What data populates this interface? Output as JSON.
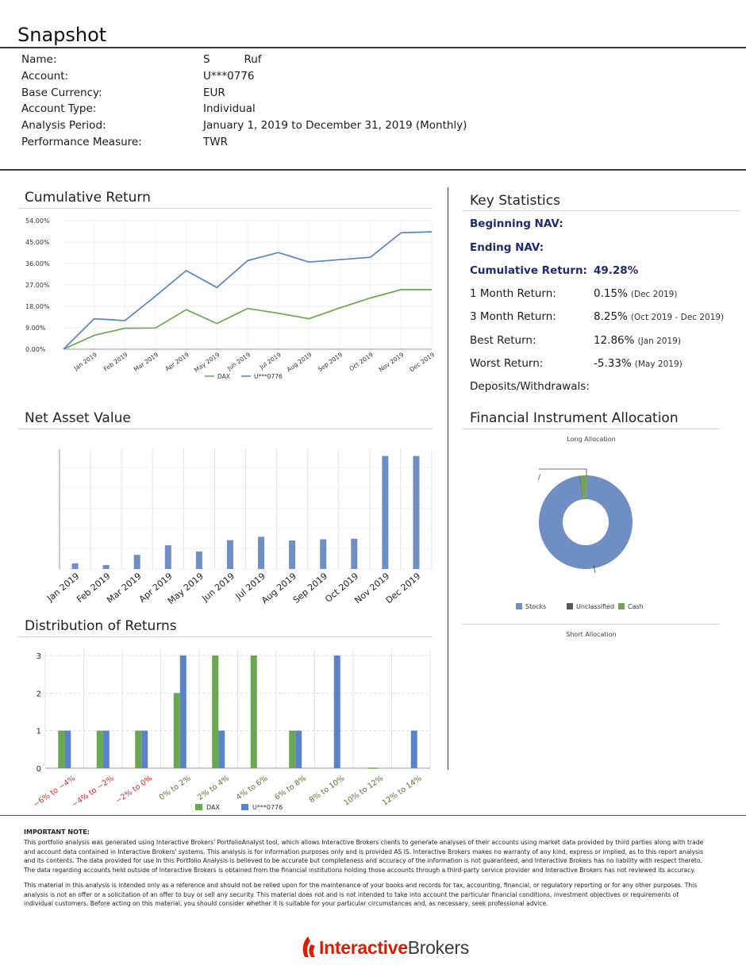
{
  "page": {
    "title": "Snapshot"
  },
  "account_info": [
    {
      "label": "Name:",
      "value": "S          Ruf"
    },
    {
      "label": "Account:",
      "value": "U***0776"
    },
    {
      "label": "Base Currency:",
      "value": "EUR"
    },
    {
      "label": "Account Type:",
      "value": "Individual"
    },
    {
      "label": "Analysis Period:",
      "value": "January 1, 2019 to December 31, 2019 (Monthly)"
    },
    {
      "label": "Performance Measure:",
      "value": "TWR"
    }
  ],
  "sections": {
    "cumulative_return": "Cumulative Return",
    "key_statistics": "Key Statistics",
    "net_asset_value": "Net Asset Value",
    "allocation": "Financial Instrument Allocation",
    "distribution": "Distribution of Returns"
  },
  "key_stats": {
    "beginning_nav_label": "Beginning NAV:",
    "ending_nav_label": "Ending NAV:",
    "cumulative_label": "Cumulative Return:",
    "cumulative_value": "49.28%",
    "one_month_label": "1 Month Return:",
    "one_month_value": "0.15%",
    "one_month_period": "(Dec 2019)",
    "three_month_label": "3 Month Return:",
    "three_month_value": "8.25%",
    "three_month_period": "(Oct 2019 - Dec 2019)",
    "best_label": "Best Return:",
    "best_value": "12.86%",
    "best_period": "(Jan 2019)",
    "worst_label": "Worst Return:",
    "worst_value": "-5.33%",
    "worst_period": "(May 2019)",
    "deposits_label": "Deposits/Withdrawals:"
  },
  "allocation": {
    "long_title": "Long Allocation",
    "short_title": "Short Allocation",
    "slash_label": "/",
    "legend": [
      {
        "name": "Stocks",
        "color": "#6f8fc4"
      },
      {
        "name": "Unclassified",
        "color": "#5a5a5a"
      },
      {
        "name": "Cash",
        "color": "#72a456"
      }
    ]
  },
  "chart_data": [
    {
      "type": "line",
      "categories": [
        "Jan 2019",
        "Feb 2019",
        "Mar 2019",
        "Apr 2019",
        "May 2019",
        "Jun 2019",
        "Jul 2019",
        "Aug 2019",
        "Sep 2019",
        "Oct 2019",
        "Nov 2019",
        "Dec 2019"
      ],
      "y_tick_labels": [
        "54.00%",
        "45.00%",
        "36.00%",
        "27.00%",
        "18.00%",
        "9.00%",
        "0.00%"
      ],
      "ylim": [
        0,
        54
      ],
      "series": [
        {
          "name": "DAX",
          "color": "#6aa84f",
          "values": [
            0,
            5.8,
            8.8,
            8.9,
            16.6,
            10.8,
            17.1,
            15.1,
            12.8,
            17.3,
            21.5,
            25.0,
            25.0
          ]
        },
        {
          "name": "U***0776",
          "color": "#5a82c7",
          "values": [
            0,
            12.8,
            12.0,
            22.3,
            33.0,
            25.9,
            37.2,
            40.6,
            36.6,
            37.6,
            38.6,
            48.9,
            49.3
          ]
        }
      ],
      "grid": true,
      "legend_position": "bottom"
    },
    {
      "type": "bar",
      "categories": [
        "Jan 2019",
        "Feb 2019",
        "Mar 2019",
        "Apr 2019",
        "May 2019",
        "Jun 2019",
        "Jul 2019",
        "Aug 2019",
        "Sep 2019",
        "Oct 2019",
        "Nov 2019",
        "Dec 2019"
      ],
      "values": [
        5,
        3.5,
        12.5,
        21,
        15.5,
        25.5,
        28.5,
        25.2,
        26.3,
        26.8,
        100,
        100
      ],
      "color": "#6f8fc4",
      "ylim": [
        0,
        106
      ],
      "grid": true
    },
    {
      "type": "pie",
      "slices": [
        {
          "name": "Stocks",
          "value": 97.5,
          "color": "#6f8fc4"
        },
        {
          "name": "Unclassified",
          "value": 0.3,
          "color": "#5a5a5a"
        },
        {
          "name": "Cash",
          "value": 2.2,
          "color": "#72a456"
        }
      ]
    },
    {
      "type": "bar",
      "categories": [
        "−6% to −4%",
        "−4% to −2%",
        "−2% to 0%",
        "0% to 2%",
        "2% to 4%",
        "4% to 6%",
        "6% to 8%",
        "8% to 10%",
        "10% to 12%",
        "12% to 14%"
      ],
      "category_colors": [
        "#d0312d",
        "#d0312d",
        "#d0312d",
        "#6b6b3a",
        "#6b6b3a",
        "#6b6b3a",
        "#6b6b3a",
        "#6b6b3a",
        "#6b6b3a",
        "#6b6b3a"
      ],
      "series": [
        {
          "name": "DAX",
          "color": "#6aa84f",
          "values": [
            1,
            1,
            1,
            2,
            3,
            3,
            1,
            0,
            0,
            0
          ]
        },
        {
          "name": "U***0776",
          "color": "#5a82c7",
          "values": [
            1,
            1,
            1,
            3,
            1,
            0,
            1,
            3,
            0,
            1
          ]
        }
      ],
      "y_ticks": [
        "0",
        "1",
        "2",
        "3"
      ],
      "ylim": [
        0,
        3
      ],
      "grid": true,
      "legend_position": "bottom"
    }
  ],
  "footer": {
    "note_title": "IMPORTANT NOTE:",
    "paragraph1": "This portfolio analysis was generated using Interactive Brokers' PortfolioAnalyst tool, which allows Interactive Brokers clients to generate analyses of their accounts using market data provided by third parties along with trade and account data contained in Interactive Brokers' systems. This analysis is for information purposes only and is provided AS IS. Interactive Brokers makes no warranty of any kind, express or implied, as to this report analysis and its contents. The data provided for use in this Portfolio Analysis is believed to be accurate but completeness and accuracy of the information is not guaranteed, and Interactive Brokers has no liability with respect thereto. The data regarding accounts held outside of Interactive Brokers is obtained from the financial institutions holding those accounts through a third-party service provider and Interactive Brokers has not reviewed its accuracy.",
    "paragraph2": "This material in this analysis is intended only as a reference and should not be relied upon for the maintenance of your books and records for tax, accounting, financial, or regulatory reporting or for any other purposes. This analysis is not an offer or a solicitation of an offer to buy or sell any security. This material does not and is not intended to take into account the particular financial conditions, investment objectives or requirements of individual customers. Before acting on this material, you should consider whether it is suitable for your particular circumstances and, as necessary, seek professional advice.",
    "brand_part1": "Interactive",
    "brand_part2": "Brokers",
    "brand_red": "#d81e05"
  }
}
